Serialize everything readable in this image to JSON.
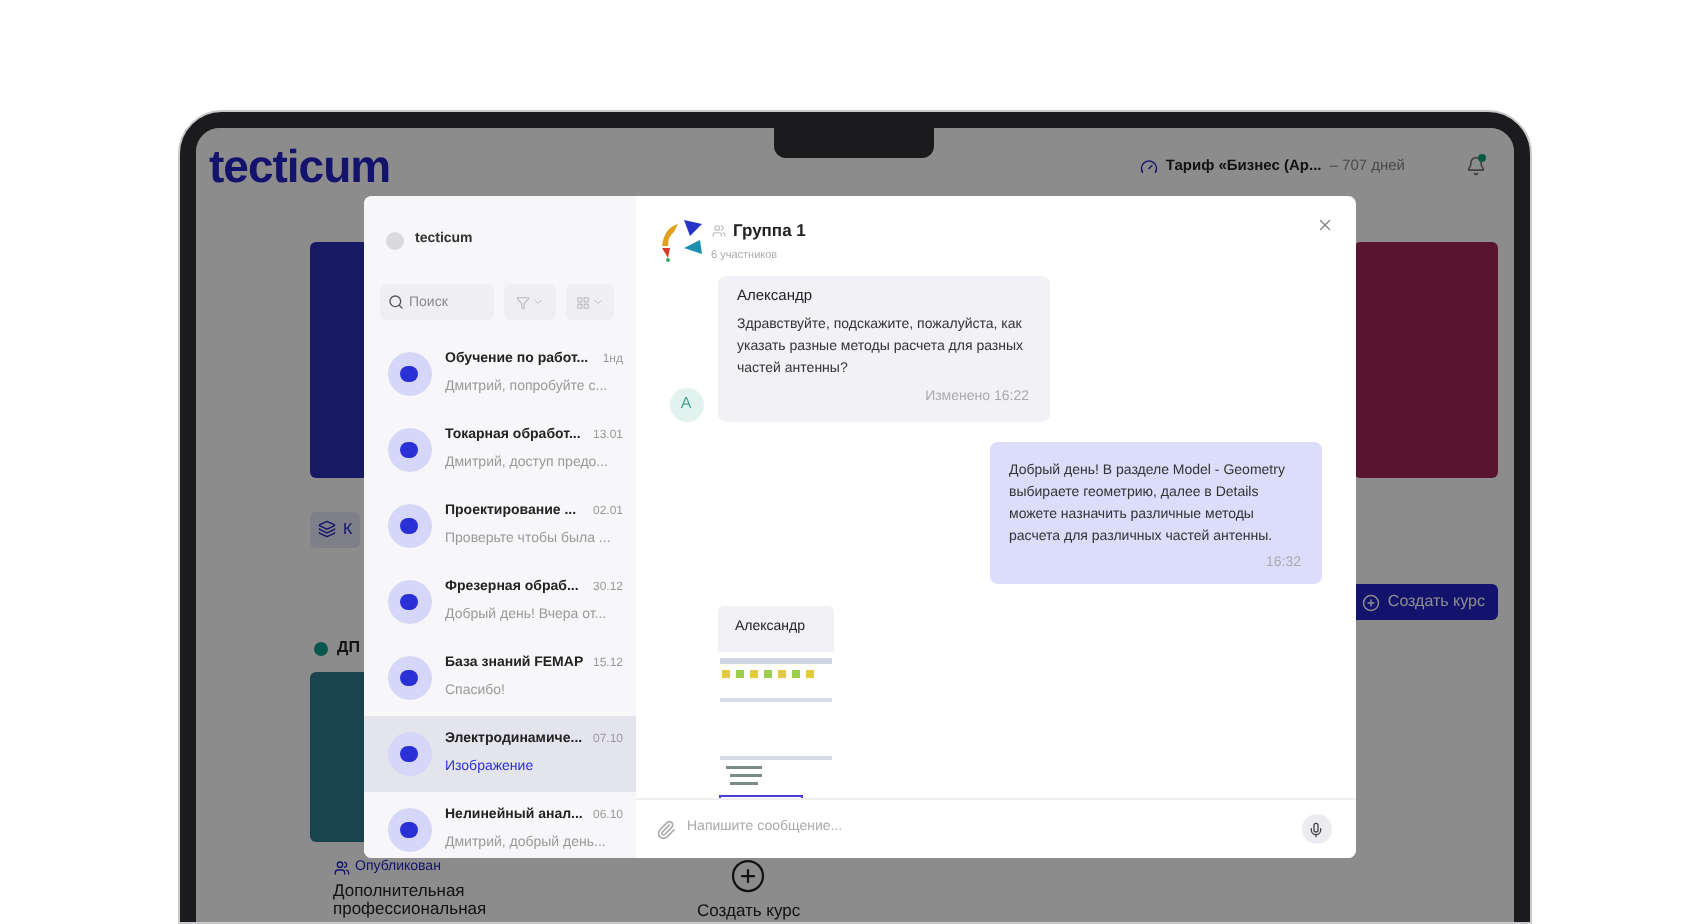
{
  "background_page": {
    "logo": "tecticum",
    "tariff": {
      "name": "Тариф «Бизнес (Ар...",
      "days": "– 707 дней"
    },
    "tab_button": "К",
    "section_title": "ДП",
    "create_course_button": "Создать курс",
    "course_card": {
      "status": "Опубликован",
      "title": "Дополнительная профессиональная"
    },
    "create_course_tile": "Создать курс"
  },
  "chat_sidebar": {
    "account": "tecticum",
    "search": {
      "placeholder": "Поиск"
    },
    "chats": [
      {
        "title": "Обучение по работ...",
        "time": "1нд",
        "preview": "Дмитрий, попробуйте с...",
        "kind": "text",
        "selected": false
      },
      {
        "title": "Токарная обработ...",
        "time": "13.01",
        "preview": "Дмитрий, доступ предо...",
        "kind": "text",
        "selected": false
      },
      {
        "title": "Проектирование ...",
        "time": "02.01",
        "preview": "Проверьте чтобы была ...",
        "kind": "text",
        "selected": false
      },
      {
        "title": "Фрезерная обраб...",
        "time": "30.12",
        "preview": "Добрый день! Вчера от...",
        "kind": "text",
        "selected": false
      },
      {
        "title": "База знаний FEMAP",
        "time": "15.12",
        "preview": "Спасибо!",
        "kind": "text",
        "selected": false
      },
      {
        "title": "Электродинамиче...",
        "time": "07.10",
        "preview": "Изображение",
        "kind": "attachment",
        "selected": true
      },
      {
        "title": "Нелинейный анал...",
        "time": "06.10",
        "preview": "Дмитрий, добрый день...",
        "kind": "text",
        "selected": false
      }
    ]
  },
  "chat": {
    "title": "Группа 1",
    "members": "6 участников",
    "messages": [
      {
        "kind": "incoming",
        "author": "Александр",
        "avatar": "А",
        "text": "Здравствуйте, подскажите, пожалуйста, как указать разные методы расчета для разных частей антенны?",
        "time": "Изменено 16:22"
      },
      {
        "kind": "outgoing",
        "text": "Добрый день! В разделе Model - Geometry выбираете геометрию, далее в Details можете назначить различные методы расчета для различных частей антенны.",
        "time": "16:32"
      },
      {
        "kind": "image",
        "author": "Александр"
      }
    ],
    "composer": {
      "placeholder": "Напишите сообщение..."
    }
  }
}
